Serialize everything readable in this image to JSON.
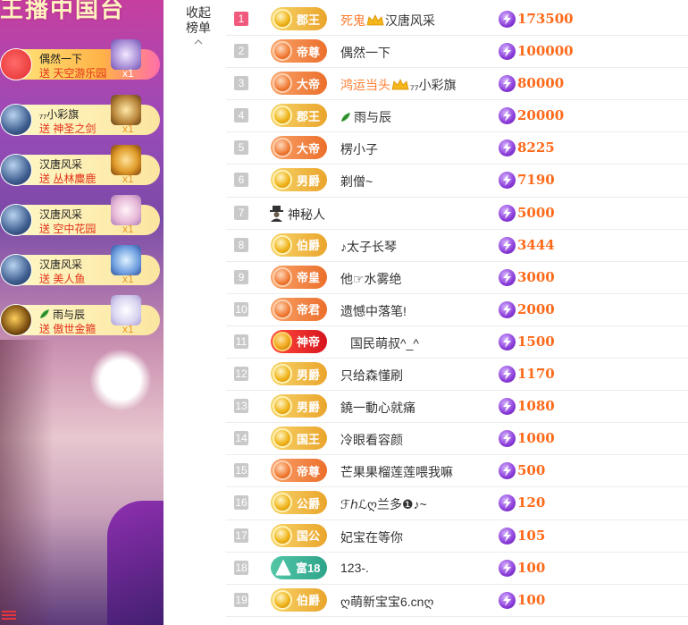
{
  "stream": {
    "title": "王播中国台",
    "gifts": [
      {
        "user": "偶然一下",
        "send_label": "送 天空游乐园",
        "count": "x1"
      },
      {
        "user": "₇₇小彩旗",
        "send_label": "送 神圣之剑",
        "count": "x1"
      },
      {
        "user": "汉唐风采",
        "send_label": "送 丛林麋鹿",
        "count": "x1"
      },
      {
        "user": "汉唐风采",
        "send_label": "送 空中花园",
        "count": "x1"
      },
      {
        "user": "汉唐风采",
        "send_label": "送 美人鱼",
        "count": "x1"
      },
      {
        "user": "雨与辰",
        "send_label": "送 傲世金箍",
        "count": "x1"
      }
    ]
  },
  "panel": {
    "collapse_label_line1": "收起",
    "collapse_label_line2": "榜单"
  },
  "colors": {
    "score": "#ff6a1a",
    "highlight_name": "#ff7b2e",
    "rank1": "#f05a7c",
    "rank_default": "#c9c9c9"
  },
  "ranking": [
    {
      "rank": "1",
      "badge": "郡王",
      "style": "gold",
      "name": "死鬼",
      "name2": "汉唐风采",
      "crown": true,
      "highlight": true,
      "score": "173500"
    },
    {
      "rank": "2",
      "badge": "帝尊",
      "style": "orange",
      "name": "偶然一下",
      "score": "100000"
    },
    {
      "rank": "3",
      "badge": "大帝",
      "style": "orange",
      "name": "鸿运当头",
      "name2": "₇₇小彩旗",
      "crown": true,
      "highlight": true,
      "score": "80000"
    },
    {
      "rank": "4",
      "badge": "郡王",
      "style": "gold",
      "name": "雨与辰",
      "leaf": true,
      "score": "20000"
    },
    {
      "rank": "5",
      "badge": "大帝",
      "style": "orange",
      "name": "楞小子",
      "score": "8225"
    },
    {
      "rank": "6",
      "badge": "男爵",
      "style": "gold",
      "name": "剃僧~",
      "score": "7190"
    },
    {
      "rank": "7",
      "badge": "",
      "style": "none",
      "name": "神秘人",
      "mystery": true,
      "score": "5000"
    },
    {
      "rank": "8",
      "badge": "伯爵",
      "style": "gold",
      "name": "♪太子长琴",
      "score": "3444"
    },
    {
      "rank": "9",
      "badge": "帝皇",
      "style": "orange",
      "name": "他☞水雾绝",
      "score": "3000"
    },
    {
      "rank": "10",
      "badge": "帝君",
      "style": "orange",
      "name": "遗憾中落笔!",
      "score": "2000"
    },
    {
      "rank": "11",
      "badge": "神帝",
      "style": "red",
      "name": "国民萌叔^_^",
      "score": "1500"
    },
    {
      "rank": "12",
      "badge": "男爵",
      "style": "gold",
      "name": "只给森懂刷",
      "score": "1170"
    },
    {
      "rank": "13",
      "badge": "男爵",
      "style": "gold",
      "name": "鐃一動心就痛",
      "score": "1080"
    },
    {
      "rank": "14",
      "badge": "国王",
      "style": "gold",
      "name": "冷眼看容颜",
      "score": "1000"
    },
    {
      "rank": "15",
      "badge": "帝尊",
      "style": "orange",
      "name": "芒果果榴莲莲喂我嘛",
      "score": "500"
    },
    {
      "rank": "16",
      "badge": "公爵",
      "style": "gold",
      "name": "ℱℎℒღ兰多❶♪~",
      "score": "120"
    },
    {
      "rank": "17",
      "badge": "国公",
      "style": "gold",
      "name": "妃宝在等你",
      "score": "105"
    },
    {
      "rank": "18",
      "badge": "富18",
      "style": "green",
      "name": "123-.",
      "score": "100"
    },
    {
      "rank": "19",
      "badge": "伯爵",
      "style": "gold",
      "name": "ღ萌新宝宝6.cnღ",
      "score": "100"
    }
  ]
}
